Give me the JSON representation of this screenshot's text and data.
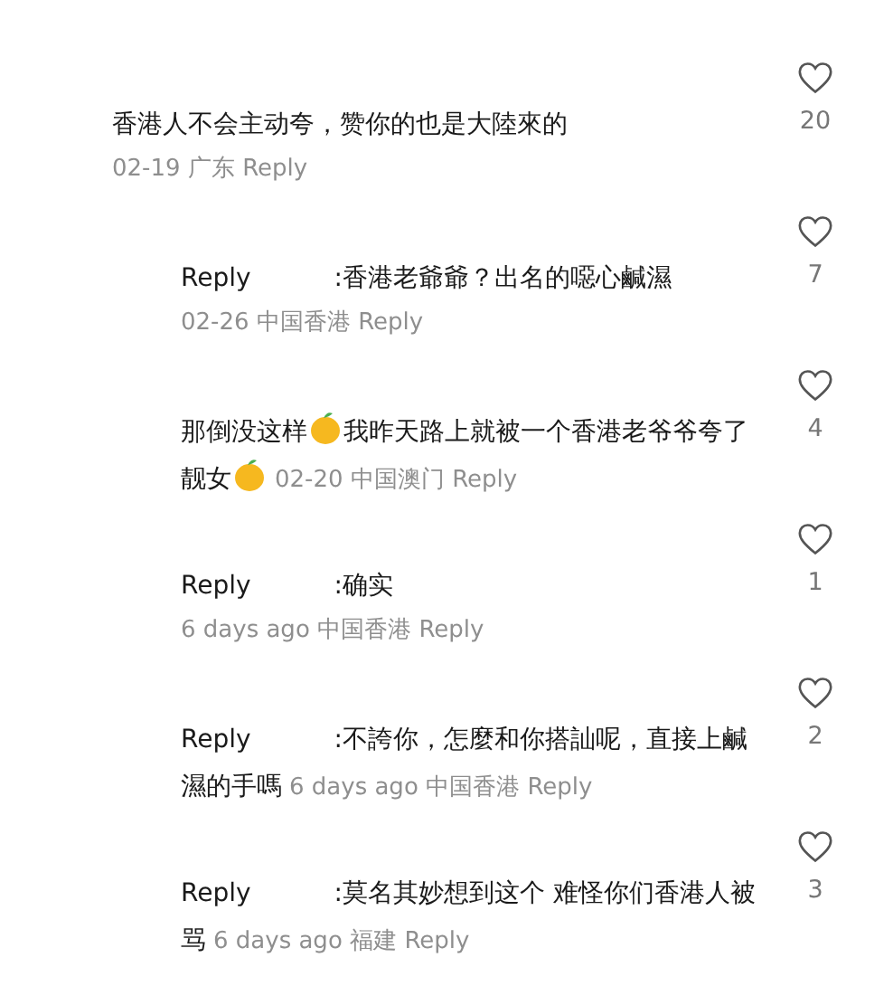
{
  "comments": [
    {
      "nested": false,
      "segments": [
        {
          "kind": "text",
          "text": "香港人不会主动夸，赞你的也是大陸來的"
        }
      ],
      "kind": "stacked",
      "date": "02-19",
      "region": "广东",
      "reply_link": "Reply",
      "likes": "20",
      "liked": false
    },
    {
      "nested": true,
      "reply_label": "Reply",
      "segments": [
        {
          "kind": "text",
          "text": ":香港老爺爺？出名的噁心鹹濕"
        }
      ],
      "kind": "stacked",
      "date": "02-26",
      "region": "中国香港",
      "reply_link": "Reply",
      "likes": "7",
      "liked": false
    },
    {
      "nested": true,
      "segments": [
        {
          "kind": "text",
          "text": "那倒没这样"
        },
        {
          "kind": "emoji"
        },
        {
          "kind": "text",
          "text": "我昨天路上就被一个香港老爷爷夸了靓女"
        },
        {
          "kind": "emoji"
        }
      ],
      "kind": "inline",
      "date": "02-20",
      "region": "中国澳门",
      "reply_link": "Reply",
      "likes": "4",
      "liked": false
    },
    {
      "nested": true,
      "reply_label": "Reply",
      "segments": [
        {
          "kind": "text",
          "text": ":确实"
        }
      ],
      "kind": "stacked",
      "date": "6 days ago",
      "region": "中国香港",
      "reply_link": "Reply",
      "likes": "1",
      "liked": false
    },
    {
      "nested": true,
      "reply_label": "Reply",
      "segments": [
        {
          "kind": "text",
          "text": ":不誇你，怎麼和你搭訕呢，直接上鹹濕的手嗎"
        }
      ],
      "kind": "inline",
      "date": "6 days ago",
      "region": "中国香港",
      "reply_link": "Reply",
      "likes": "2",
      "liked": false
    },
    {
      "nested": true,
      "reply_label": "Reply",
      "segments": [
        {
          "kind": "text",
          "text": ":莫名其妙想到这个 难怪你们香港人被骂"
        }
      ],
      "kind": "inline",
      "date": "6 days ago",
      "region": "福建",
      "reply_link": "Reply",
      "likes": "3",
      "liked": false
    }
  ]
}
